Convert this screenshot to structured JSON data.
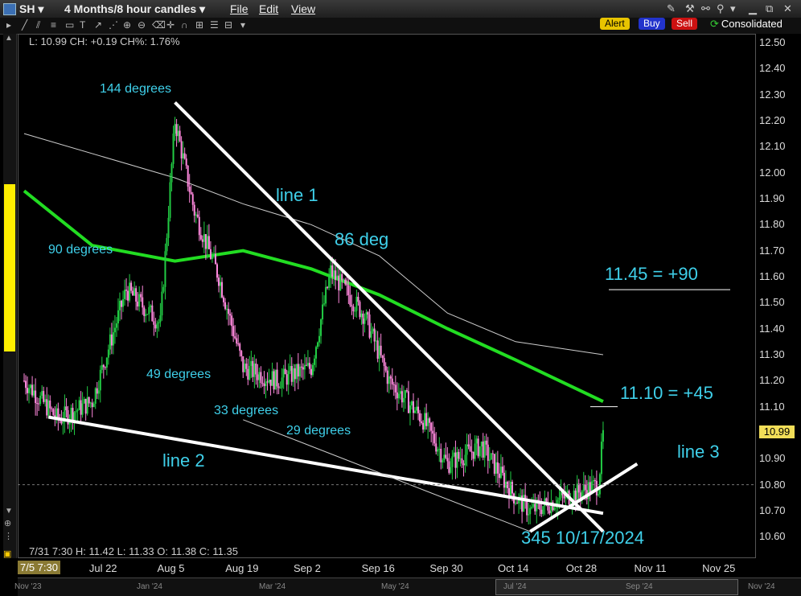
{
  "titlebar": {
    "ticker": "SH",
    "timeframe": "4 Months/8 hour candles",
    "menu": [
      "File",
      "Edit",
      "View"
    ]
  },
  "toolbar": {
    "alert": "Alert",
    "buy": "Buy",
    "sell": "Sell",
    "consolidated": "Consolidated"
  },
  "header_info": "L: 10.99 CH: +0.19 CH%: 1.76%",
  "crosshair_info": "7/31 7:30  H: 11.42  L: 11.33  O: 11.38  C: 11.35",
  "last_price": "10.99",
  "x_cursor_label": "7/5 7:30",
  "navigator_labels": [
    "Nov '23",
    "Jan '24",
    "Mar '24",
    "May '24",
    "Jul '24",
    "Sep '24",
    "Nov '24"
  ],
  "annotations": {
    "a144": "144 degrees",
    "line1": "line 1",
    "a86": "86 deg",
    "a90": "90 degrees",
    "p1145": "11.45 = +90",
    "p1110": "11.10 = +45",
    "a49": "49 degrees",
    "a33": "33 degrees",
    "a29": "29 degrees",
    "line2": "line 2",
    "line3": "line 3",
    "a345": "345 10/17/2024"
  },
  "chart_data": {
    "type": "candlestick",
    "symbol": "SH",
    "interval": "8 hour",
    "y_ticks": [
      12.5,
      12.4,
      12.3,
      12.2,
      12.1,
      12.0,
      11.9,
      11.8,
      11.7,
      11.6,
      11.5,
      11.4,
      11.3,
      11.2,
      11.1,
      11.0,
      10.9,
      10.8,
      10.7,
      10.6
    ],
    "ylim": [
      10.55,
      12.53
    ],
    "x_ticks": [
      "Jul 22",
      "Aug 5",
      "Aug 19",
      "Sep 2",
      "Sep 16",
      "Sep 30",
      "Oct 14",
      "Oct 28",
      "Nov 11",
      "Nov 25"
    ],
    "x_start": "Jul 5",
    "close_path": [
      [
        "Jul 5",
        11.2
      ],
      [
        "Jul 12",
        11.05
      ],
      [
        "Jul 19",
        11.12
      ],
      [
        "Jul 26",
        11.55
      ],
      [
        "Aug 2",
        11.42
      ],
      [
        "Aug 5",
        12.2
      ],
      [
        "Aug 9",
        11.85
      ],
      [
        "Aug 14",
        11.6
      ],
      [
        "Aug 19",
        11.25
      ],
      [
        "Aug 26",
        11.2
      ],
      [
        "Sep 2",
        11.25
      ],
      [
        "Sep 6",
        11.62
      ],
      [
        "Sep 13",
        11.45
      ],
      [
        "Sep 18",
        11.2
      ],
      [
        "Sep 25",
        11.05
      ],
      [
        "Sep 30",
        10.88
      ],
      [
        "Oct 7",
        10.95
      ],
      [
        "Oct 14",
        10.75
      ],
      [
        "Oct 17",
        10.7
      ],
      [
        "Oct 24",
        10.75
      ],
      [
        "Oct 31",
        10.8
      ],
      [
        "Nov 1",
        10.99
      ]
    ],
    "current": {
      "last": 10.99,
      "change": 0.19,
      "change_pct": 1.76
    },
    "moving_averages": [
      {
        "color": "#22dd22",
        "points": [
          [
            "Jul 5",
            11.93
          ],
          [
            "Jul 19",
            11.72
          ],
          [
            "Aug 5",
            11.66
          ],
          [
            "Aug 19",
            11.7
          ],
          [
            "Sep 2",
            11.63
          ],
          [
            "Sep 16",
            11.53
          ],
          [
            "Sep 30",
            11.4
          ],
          [
            "Oct 14",
            11.28
          ],
          [
            "Nov 1",
            11.12
          ]
        ]
      },
      {
        "color": "#cccccc",
        "points": [
          [
            "Jul 5",
            12.15
          ],
          [
            "Aug 5",
            11.98
          ],
          [
            "Aug 19",
            11.88
          ],
          [
            "Sep 2",
            11.8
          ],
          [
            "Sep 16",
            11.68
          ],
          [
            "Sep 30",
            11.46
          ],
          [
            "Oct 14",
            11.35
          ],
          [
            "Nov 1",
            11.3
          ]
        ]
      }
    ],
    "trendlines": [
      {
        "name": "line 1",
        "from": [
          "Aug 5",
          12.27
        ],
        "to": [
          "Nov 1",
          10.62
        ]
      },
      {
        "name": "line 2",
        "from": [
          "Jul 10",
          11.06
        ],
        "to": [
          "Nov 1",
          10.69
        ]
      },
      {
        "name": "line 3",
        "from": [
          "Oct 17",
          10.62
        ],
        "to": [
          "Nov 8",
          10.88
        ]
      },
      {
        "name": "29 degrees",
        "from": [
          "Aug 19",
          11.05
        ],
        "to": [
          "Oct 17",
          10.62
        ]
      }
    ],
    "levels": [
      {
        "label": "11.45 = +90",
        "value": 11.55
      },
      {
        "label": "11.10 = +45",
        "value": 11.1
      },
      {
        "value": 10.8
      }
    ]
  }
}
